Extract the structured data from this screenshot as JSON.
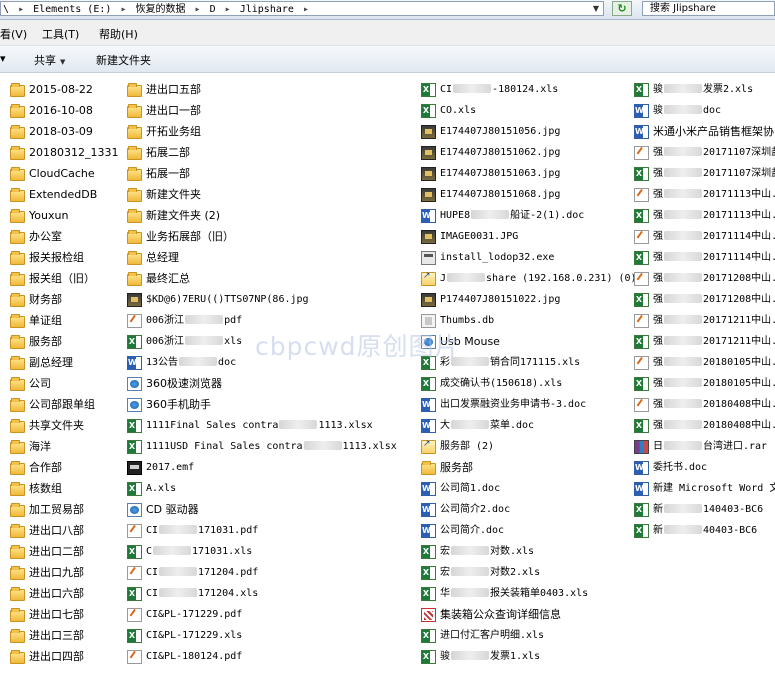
{
  "address_bar": {
    "prefix": "\\",
    "segments": [
      "Elements (E:)",
      "恢复的数据",
      "D",
      "Jlipshare"
    ],
    "search_text": "搜索 Jlipshare"
  },
  "menu": {
    "view": "看(V)",
    "tools": "工具(T)",
    "help": "帮助(H)"
  },
  "toolbar": {
    "share": "共享",
    "new_folder": "新建文件夹"
  },
  "watermark": "cbpcwd原创图片",
  "columns": [
    [
      {
        "type": "folder",
        "parts": [
          "2015-08-22"
        ]
      },
      {
        "type": "folder",
        "parts": [
          "2016-10-08"
        ]
      },
      {
        "type": "folder",
        "parts": [
          "2018-03-09"
        ]
      },
      {
        "type": "folder",
        "parts": [
          "20180312_1331"
        ]
      },
      {
        "type": "folder",
        "parts": [
          "CloudCache"
        ]
      },
      {
        "type": "folder",
        "parts": [
          "ExtendedDB"
        ]
      },
      {
        "type": "folder",
        "parts": [
          "Youxun"
        ]
      },
      {
        "type": "folder",
        "parts": [
          "办公室"
        ]
      },
      {
        "type": "folder",
        "parts": [
          "报关报检组"
        ]
      },
      {
        "type": "folder",
        "parts": [
          "报关组（旧）"
        ]
      },
      {
        "type": "folder",
        "parts": [
          "财务部"
        ]
      },
      {
        "type": "folder",
        "parts": [
          "单证组"
        ]
      },
      {
        "type": "folder",
        "parts": [
          "服务部"
        ]
      },
      {
        "type": "folder",
        "parts": [
          "副总经理"
        ]
      },
      {
        "type": "folder",
        "parts": [
          "公司"
        ]
      },
      {
        "type": "folder",
        "parts": [
          "公司部跟单组"
        ]
      },
      {
        "type": "folder",
        "parts": [
          "共享文件夹"
        ]
      },
      {
        "type": "folder",
        "parts": [
          "海洋"
        ]
      },
      {
        "type": "folder",
        "parts": [
          "合作部"
        ]
      },
      {
        "type": "folder",
        "parts": [
          "核数组"
        ]
      },
      {
        "type": "folder",
        "parts": [
          "加工贸易部"
        ]
      },
      {
        "type": "folder",
        "parts": [
          "进出口八部"
        ]
      },
      {
        "type": "folder",
        "parts": [
          "进出口二部"
        ]
      },
      {
        "type": "folder",
        "parts": [
          "进出口九部"
        ]
      },
      {
        "type": "folder",
        "parts": [
          "进出口六部"
        ]
      },
      {
        "type": "folder",
        "parts": [
          "进出口七部"
        ]
      },
      {
        "type": "folder",
        "parts": [
          "进出口三部"
        ]
      },
      {
        "type": "folder",
        "parts": [
          "进出口四部"
        ]
      }
    ],
    [
      {
        "type": "folder",
        "parts": [
          "进出口五部"
        ]
      },
      {
        "type": "folder",
        "parts": [
          "进出口一部"
        ]
      },
      {
        "type": "folder",
        "parts": [
          "开拓业务组"
        ]
      },
      {
        "type": "folder",
        "parts": [
          "拓展二部"
        ]
      },
      {
        "type": "folder",
        "parts": [
          "拓展一部"
        ]
      },
      {
        "type": "folder",
        "parts": [
          "新建文件夹"
        ]
      },
      {
        "type": "folder",
        "parts": [
          "新建文件夹 (2)"
        ]
      },
      {
        "type": "folder",
        "parts": [
          "业务拓展部（旧）"
        ]
      },
      {
        "type": "folder",
        "parts": [
          "总经理"
        ]
      },
      {
        "type": "folder",
        "parts": [
          "最终汇总"
        ]
      },
      {
        "type": "jpg",
        "parts": [
          "$KD@6)7ERU(()TTS07NP(86.jpg"
        ]
      },
      {
        "type": "pdf",
        "parts": [
          "006浙江",
          "",
          "pdf"
        ]
      },
      {
        "type": "xls",
        "parts": [
          "006浙江",
          "",
          "xls"
        ]
      },
      {
        "type": "doc",
        "parts": [
          "13公告",
          "",
          "doc"
        ]
      },
      {
        "type": "lnk",
        "parts": [
          "360极速浏览器"
        ]
      },
      {
        "type": "lnk",
        "parts": [
          "360手机助手"
        ]
      },
      {
        "type": "xls",
        "parts": [
          "1111Final Sales contra",
          "",
          "1113.xlsx"
        ]
      },
      {
        "type": "xls",
        "parts": [
          "1111USD Final Sales contra",
          "",
          "1113.xlsx"
        ]
      },
      {
        "type": "emf",
        "parts": [
          "2017.emf"
        ]
      },
      {
        "type": "xls",
        "parts": [
          "A.xls"
        ]
      },
      {
        "type": "lnk",
        "parts": [
          "CD 驱动器"
        ]
      },
      {
        "type": "pdf",
        "parts": [
          "CI",
          "",
          "171031.pdf"
        ]
      },
      {
        "type": "xls",
        "parts": [
          "C",
          "",
          "171031.xls"
        ]
      },
      {
        "type": "pdf",
        "parts": [
          "CI",
          "",
          "171204.pdf"
        ]
      },
      {
        "type": "xls",
        "parts": [
          "CI",
          "",
          "171204.xls"
        ]
      },
      {
        "type": "pdf",
        "parts": [
          "CI&PL-171229.pdf"
        ]
      },
      {
        "type": "xls",
        "parts": [
          "CI&PL-171229.xls"
        ]
      },
      {
        "type": "pdf",
        "parts": [
          "CI&PL-180124.pdf"
        ]
      }
    ],
    [
      {
        "type": "xls",
        "parts": [
          "CI",
          "",
          "-180124.xls"
        ]
      },
      {
        "type": "xls",
        "parts": [
          "CO.xls"
        ]
      },
      {
        "type": "jpg",
        "parts": [
          "E174407J80151056.jpg"
        ]
      },
      {
        "type": "jpg",
        "parts": [
          "E174407J80151062.jpg"
        ]
      },
      {
        "type": "jpg",
        "parts": [
          "E174407J80151063.jpg"
        ]
      },
      {
        "type": "jpg",
        "parts": [
          "E174407J80151068.jpg"
        ]
      },
      {
        "type": "doc",
        "parts": [
          "HUPE8",
          "",
          "船证-2(1).doc"
        ]
      },
      {
        "type": "jpg",
        "parts": [
          "IMAGE0031.JPG"
        ]
      },
      {
        "type": "exe",
        "parts": [
          "install_lodop32.exe"
        ]
      },
      {
        "type": "shortcut-folder",
        "parts": [
          "J",
          "",
          "share (192.168.0.231) (0)"
        ]
      },
      {
        "type": "jpg",
        "parts": [
          "P174407J80151022.jpg"
        ]
      },
      {
        "type": "db",
        "parts": [
          "Thumbs.db"
        ]
      },
      {
        "type": "lnk",
        "parts": [
          "Usb Mouse"
        ]
      },
      {
        "type": "xls",
        "parts": [
          "彩",
          "",
          "销合同171115.xls"
        ]
      },
      {
        "type": "xls",
        "parts": [
          "成交确认书(150618).xls"
        ]
      },
      {
        "type": "doc",
        "parts": [
          "出口发票融资业务申请书-3.doc"
        ]
      },
      {
        "type": "doc",
        "parts": [
          "大",
          "",
          "菜单.doc"
        ]
      },
      {
        "type": "shortcut-folder",
        "parts": [
          "服务部 (2)"
        ]
      },
      {
        "type": "folder",
        "parts": [
          "服务部"
        ]
      },
      {
        "type": "doc",
        "parts": [
          "公司简1.doc"
        ]
      },
      {
        "type": "doc",
        "parts": [
          "公司简介2.doc"
        ]
      },
      {
        "type": "doc",
        "parts": [
          "公司简介.doc"
        ]
      },
      {
        "type": "xls",
        "parts": [
          "宏",
          "",
          "对数.xls"
        ]
      },
      {
        "type": "xls",
        "parts": [
          "宏",
          "",
          "对数2.xls"
        ]
      },
      {
        "type": "xls",
        "parts": [
          "华",
          "",
          "报关装箱单0403.xls"
        ]
      },
      {
        "type": "msg",
        "parts": [
          "集装箱公众查询详细信息"
        ]
      },
      {
        "type": "xls",
        "parts": [
          "进口付汇客户明细.xls"
        ]
      },
      {
        "type": "xls",
        "parts": [
          "骏",
          "",
          "发票1.xls"
        ]
      }
    ],
    [
      {
        "type": "xls",
        "parts": [
          "骏",
          "",
          "发票2.xls"
        ]
      },
      {
        "type": "doc",
        "parts": [
          "骏",
          "",
          "doc"
        ]
      },
      {
        "type": "doc",
        "parts": [
          "米通小米产品销售框架协"
        ]
      },
      {
        "type": "pdf",
        "parts": [
          "强",
          "",
          "20171107深圳盐田."
        ]
      },
      {
        "type": "xls",
        "parts": [
          "强",
          "",
          "20171107深圳盐田."
        ]
      },
      {
        "type": "pdf",
        "parts": [
          "强",
          "",
          "20171113中山.pdf"
        ]
      },
      {
        "type": "xls",
        "parts": [
          "强",
          "",
          "20171113中山.xls"
        ]
      },
      {
        "type": "pdf",
        "parts": [
          "强",
          "",
          "20171114中山.pdf"
        ]
      },
      {
        "type": "xls",
        "parts": [
          "强",
          "",
          "20171114中山.xls"
        ]
      },
      {
        "type": "pdf",
        "parts": [
          "强",
          "",
          "20171208中山.pdf"
        ]
      },
      {
        "type": "xls",
        "parts": [
          "强",
          "",
          "20171208中山.xls"
        ]
      },
      {
        "type": "pdf",
        "parts": [
          "强",
          "",
          "20171211中山.pdf"
        ]
      },
      {
        "type": "xls",
        "parts": [
          "强",
          "",
          "20171211中山.xls"
        ]
      },
      {
        "type": "pdf",
        "parts": [
          "强",
          "",
          "20180105中山.pdf"
        ]
      },
      {
        "type": "xls",
        "parts": [
          "强",
          "",
          "20180105中山.xls"
        ]
      },
      {
        "type": "pdf",
        "parts": [
          "强",
          "",
          "20180408中山.pdf"
        ]
      },
      {
        "type": "xls",
        "parts": [
          "强",
          "",
          "20180408中山.xls"
        ]
      },
      {
        "type": "rar",
        "parts": [
          "日",
          "",
          "台湾进口.rar"
        ]
      },
      {
        "type": "doc",
        "parts": [
          "委托书.doc"
        ]
      },
      {
        "type": "doc",
        "parts": [
          "新建 Microsoft Word 文"
        ]
      },
      {
        "type": "xls",
        "parts": [
          "新",
          "",
          "140403-BC6"
        ]
      },
      {
        "type": "xls",
        "parts": [
          "新",
          "",
          "40403-BC6"
        ]
      }
    ]
  ]
}
